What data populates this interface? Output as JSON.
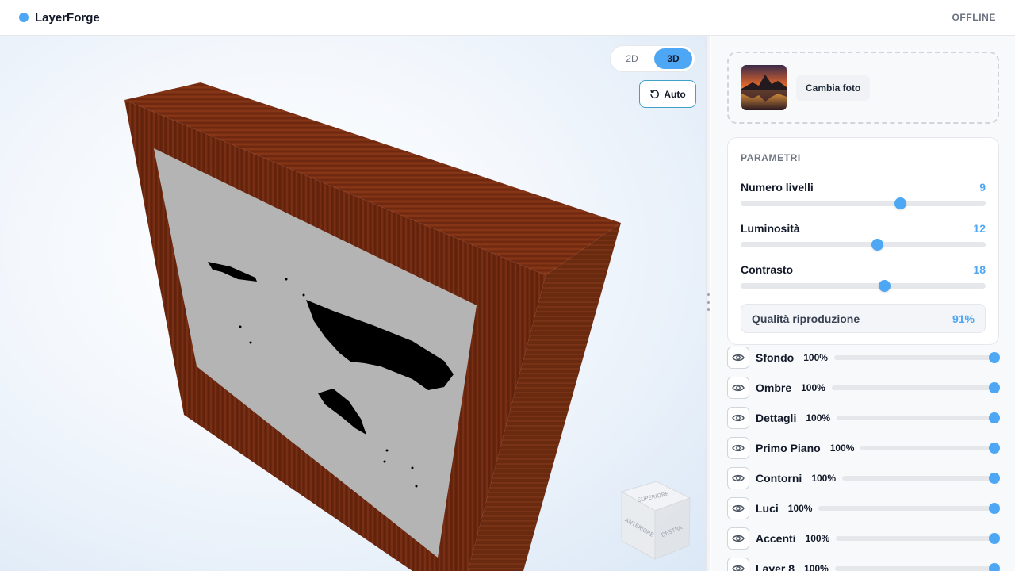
{
  "header": {
    "brand": "LayerForge",
    "status": "OFFLINE"
  },
  "viewport": {
    "toggle": {
      "option_2d": "2D",
      "option_3d": "3D",
      "active": "3D"
    },
    "auto_label": "Auto",
    "navcube": {
      "top": "SUPERIORE",
      "front": "ANTERIORE",
      "right": "DESTRA"
    }
  },
  "panel": {
    "change_photo": "Cambia foto",
    "params_title": "PARAMETRI",
    "params": [
      {
        "label": "Numero livelli",
        "value": "9",
        "level": 0.65
      },
      {
        "label": "Luminosità",
        "value": "12",
        "level": 0.556
      },
      {
        "label": "Contrasto",
        "value": "18",
        "level": 0.585
      }
    ],
    "quality": {
      "label": "Qualità riproduzione",
      "value": "91%"
    },
    "layers": [
      {
        "name": "Sfondo",
        "opacity": "100%",
        "level": 1
      },
      {
        "name": "Ombre",
        "opacity": "100%",
        "level": 1
      },
      {
        "name": "Dettagli",
        "opacity": "100%",
        "level": 1
      },
      {
        "name": "Primo Piano",
        "opacity": "100%",
        "level": 1
      },
      {
        "name": "Contorni",
        "opacity": "100%",
        "level": 1
      },
      {
        "name": "Luci",
        "opacity": "100%",
        "level": 1
      },
      {
        "name": "Accenti",
        "opacity": "100%",
        "level": 1
      },
      {
        "name": "Layer 8",
        "opacity": "100%",
        "level": 1
      }
    ]
  },
  "colors": {
    "accent": "#4ea7f5",
    "wood": "#7a2e12",
    "panel_surface": "#b4b4b4"
  }
}
